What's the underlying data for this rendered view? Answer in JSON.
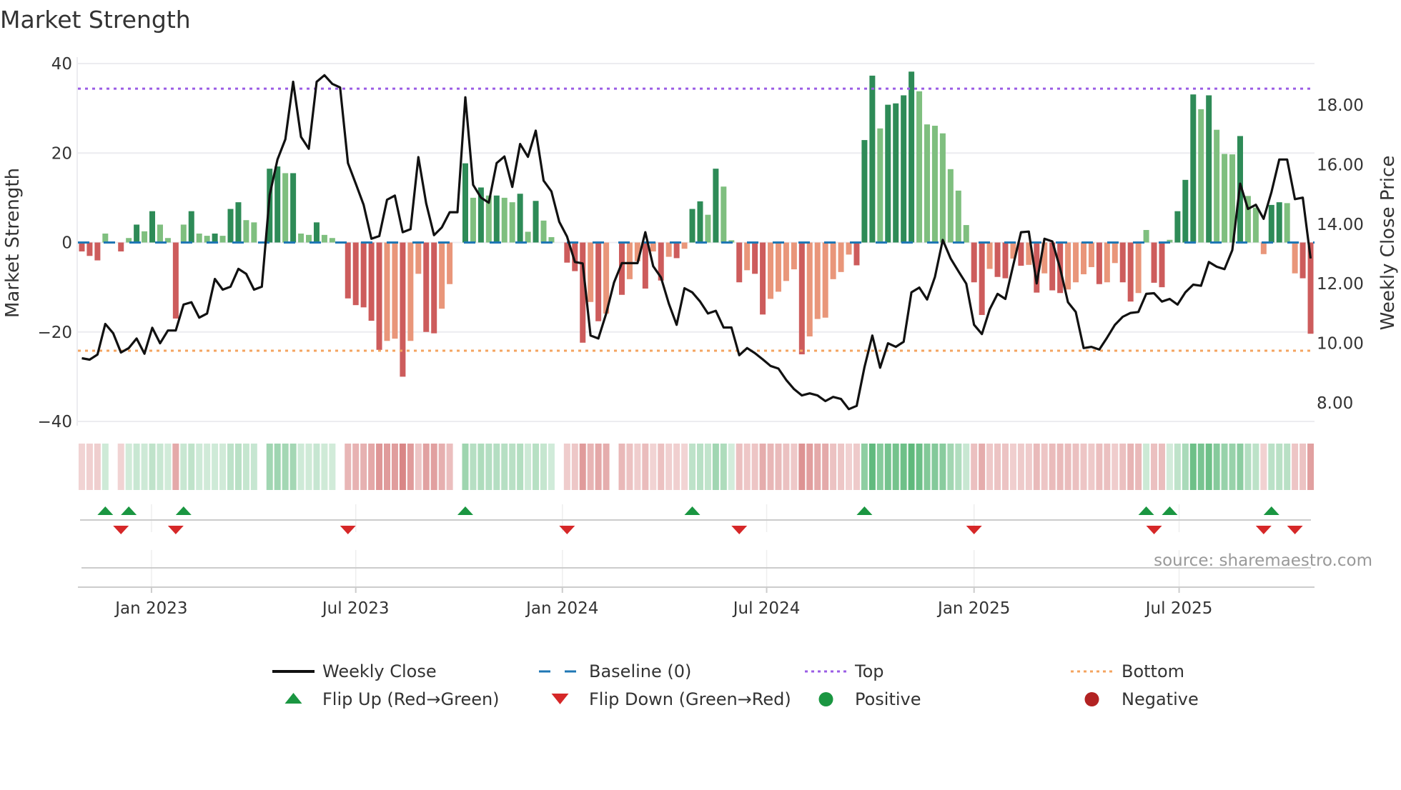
{
  "chart_data": {
    "type": "bar",
    "title": "Market Strength",
    "ylabel": "Market Strength",
    "ylabel_right": "Weekly Close Price",
    "ylim": [
      -40,
      40
    ],
    "ylim_right": [
      7.2,
      19.2
    ],
    "yticks": [
      40,
      20,
      0,
      -20,
      -40
    ],
    "yticks_labels": [
      "40",
      "20",
      "0",
      "−20",
      "−40"
    ],
    "yticks_right": [
      18,
      16,
      14,
      12,
      10,
      8
    ],
    "yticks_right_labels": [
      "18.00",
      "16.00",
      "14.00",
      "12.00",
      "10.00",
      "8.00"
    ],
    "x_unit": "week index (1 = first weekly bar)",
    "xlim": [
      0.5,
      158.5
    ],
    "xticks": [
      {
        "label": "Jan 2023",
        "week": 9.9
      },
      {
        "label": "Jul 2023",
        "week": 36.0
      },
      {
        "label": "Jan 2024",
        "week": 62.4
      },
      {
        "label": "Jul 2024",
        "week": 88.5
      },
      {
        "label": "Jan 2025",
        "week": 115.0
      },
      {
        "label": "Jul 2025",
        "week": 141.2
      }
    ],
    "top_level": 34.4,
    "bottom_level": -24.2,
    "baseline": 0,
    "strength": [
      -2,
      -3,
      -4,
      2,
      0,
      -2,
      1,
      4,
      2.5,
      7,
      4,
      1,
      -17,
      4,
      7,
      2,
      1.5,
      2,
      1.5,
      7.5,
      9,
      5,
      4.5,
      0,
      16.5,
      17,
      15.5,
      15.5,
      2,
      1.7,
      4.5,
      1.7,
      1,
      0,
      -12.5,
      -14,
      -14.5,
      -17.5,
      -24,
      -22,
      -21.5,
      -30,
      -22,
      -7,
      -20,
      -20.3,
      -14.8,
      -9.3,
      0,
      17.7,
      10,
      12.3,
      10.5,
      10.5,
      10,
      9,
      10.9,
      2.4,
      9.3,
      4.9,
      1.2,
      0,
      -4.5,
      -6.4,
      -22.4,
      -13.3,
      -17.6,
      -15.9,
      0,
      -11.7,
      -8.2,
      -4.2,
      -10.3,
      -2,
      -8.5,
      -3.2,
      -3.5,
      -1.4,
      7.5,
      9.2,
      6.2,
      16.5,
      12.5,
      0.5,
      -8.9,
      -6.2,
      -7,
      -16.1,
      -12.6,
      -11,
      -8.6,
      -6,
      -25,
      -21,
      -17.1,
      -16.8,
      -8.2,
      -6.6,
      -2.7,
      -5.1,
      22.9,
      37.3,
      25.5,
      30.8,
      31.1,
      32.9,
      38.2,
      33.8,
      26.4,
      26.1,
      24.4,
      16.4,
      11.6,
      3.9,
      -8.9,
      -16.2,
      -5.9,
      -7.7,
      -8,
      -3.6,
      -5.2,
      -5,
      -11.2,
      -6.9,
      -10.7,
      -11.3,
      -10.5,
      -8.9,
      -7.1,
      -5.5,
      -9.3,
      -8.9,
      -4.6,
      -8.9,
      -13.2,
      -11.3,
      2.8,
      -9,
      -10,
      0.6,
      7,
      14,
      33.1,
      29.8,
      32.9,
      25.2,
      19.8,
      19.7,
      23.8,
      10.4,
      7.8,
      -2.6,
      8.4,
      9,
      8.8,
      -6.9,
      -8,
      -20.4
    ],
    "weekly_close": [
      9.5,
      9.45,
      9.62,
      10.65,
      10.34,
      9.69,
      9.84,
      10.16,
      9.65,
      10.52,
      10.0,
      10.43,
      10.43,
      11.3,
      11.38,
      10.86,
      11.0,
      12.16,
      11.8,
      11.9,
      12.5,
      12.33,
      11.8,
      11.9,
      14.98,
      16.17,
      16.85,
      18.78,
      16.93,
      16.53,
      18.78,
      19.0,
      18.71,
      18.59,
      16.05,
      15.36,
      14.65,
      13.51,
      13.6,
      14.82,
      14.96,
      13.73,
      13.83,
      16.25,
      14.7,
      13.63,
      13.89,
      14.4,
      14.4,
      18.26,
      15.32,
      14.89,
      14.72,
      16.05,
      16.27,
      15.25,
      16.69,
      16.26,
      17.14,
      15.46,
      15.1,
      14.08,
      13.58,
      12.73,
      12.68,
      10.26,
      10.16,
      11.0,
      12.04,
      12.69,
      12.69,
      12.69,
      13.73,
      12.59,
      12.21,
      11.33,
      10.62,
      11.85,
      11.71,
      11.4,
      11.0,
      11.09,
      10.53,
      10.53,
      9.6,
      9.84,
      9.67,
      9.46,
      9.24,
      9.15,
      8.77,
      8.46,
      8.25,
      8.32,
      8.25,
      8.06,
      8.2,
      8.13,
      7.79,
      7.9,
      9.2,
      10.26,
      9.18,
      10.0,
      9.88,
      10.05,
      11.71,
      11.87,
      11.47,
      12.23,
      13.47,
      12.85,
      12.42,
      12.0,
      10.62,
      10.31,
      11.14,
      11.66,
      11.49,
      12.61,
      13.73,
      13.75,
      12.01,
      13.51,
      13.42,
      12.52,
      11.38,
      11.05,
      9.84,
      9.88,
      9.79,
      10.19,
      10.62,
      10.89,
      11.02,
      11.05,
      11.66,
      11.68,
      11.4,
      11.49,
      11.3,
      11.71,
      11.97,
      11.93,
      12.73,
      12.57,
      12.49,
      13.13,
      15.36,
      14.51,
      14.65,
      14.18,
      15.08,
      16.17,
      16.17,
      14.84,
      14.89,
      12.85
    ],
    "flip_up_weeks": [
      4,
      7,
      14,
      50,
      79,
      101,
      137,
      140,
      153
    ],
    "flip_down_weeks": [
      6,
      13,
      35,
      63,
      85,
      115,
      138,
      152,
      156
    ],
    "colors": {
      "strong_positive": "#2e8b57",
      "weak_positive": "#7fbf7f",
      "strong_negative": "#cd5c5c",
      "weak_negative": "#e9967a",
      "close_line": "#111111",
      "baseline": "#1f77b4",
      "top": "#9b5de5",
      "bottom": "#f4a460",
      "flip_up": "#1a9641",
      "flip_down": "#d62728",
      "positive": "#1a9641",
      "negative": "#b22222"
    },
    "legend": [
      {
        "label": "Weekly Close",
        "symbol": "line"
      },
      {
        "label": "Baseline (0)",
        "symbol": "dash"
      },
      {
        "label": "Top",
        "symbol": "dot-purple"
      },
      {
        "label": "Bottom",
        "symbol": "dot-orange"
      },
      {
        "label": "Flip Up (Red→Green)",
        "symbol": "triangle-up"
      },
      {
        "label": "Flip Down (Green→Red)",
        "symbol": "triangle-down"
      },
      {
        "label": "Positive",
        "symbol": "circle-green"
      },
      {
        "label": "Negative",
        "symbol": "circle-red"
      }
    ],
    "legend_placement": "bottom-center",
    "source": "source: sharemaestro.com"
  }
}
